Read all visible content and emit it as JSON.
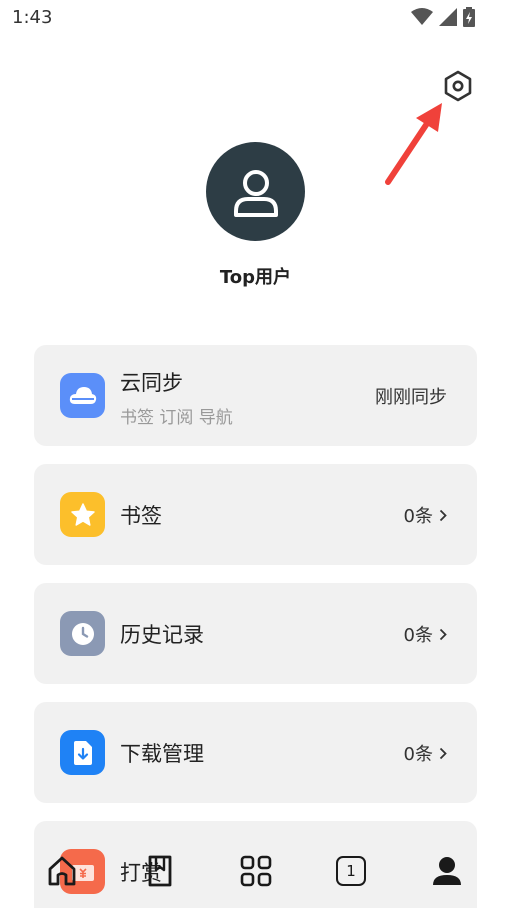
{
  "status_bar": {
    "time": "1:43",
    "icons": [
      "wifi-icon",
      "cellular-signal-icon",
      "battery-charging-icon"
    ]
  },
  "header": {
    "settings_icon": "hexagon-settings-icon",
    "annotation_arrow_color": "#f0413a"
  },
  "profile": {
    "avatar_icon": "user-icon",
    "avatar_color": "#2d3d45",
    "username": "Top用户"
  },
  "menu": {
    "cloud_sync": {
      "title": "云同步",
      "subtitle": "书签 订阅 导航",
      "status": "刚刚同步",
      "icon": "cloud-icon",
      "icon_color": "#5b8ff9"
    },
    "bookmarks": {
      "title": "书签",
      "count": "0条",
      "icon": "star-icon",
      "icon_color": "#fcbf2b"
    },
    "history": {
      "title": "历史记录",
      "count": "0条",
      "icon": "clock-icon",
      "icon_color": "#8b99b4"
    },
    "downloads": {
      "title": "下载管理",
      "count": "0条",
      "icon": "download-file-icon",
      "icon_color": "#1f82f5"
    },
    "tip": {
      "title": "打赏",
      "icon": "money-box-icon",
      "icon_color": "#f56a4b"
    }
  },
  "tab_bar": {
    "tabs": [
      "home-icon",
      "bookmark-book-icon",
      "apps-grid-icon",
      "tabs-count-icon",
      "profile-icon"
    ],
    "tab_count": "1"
  }
}
